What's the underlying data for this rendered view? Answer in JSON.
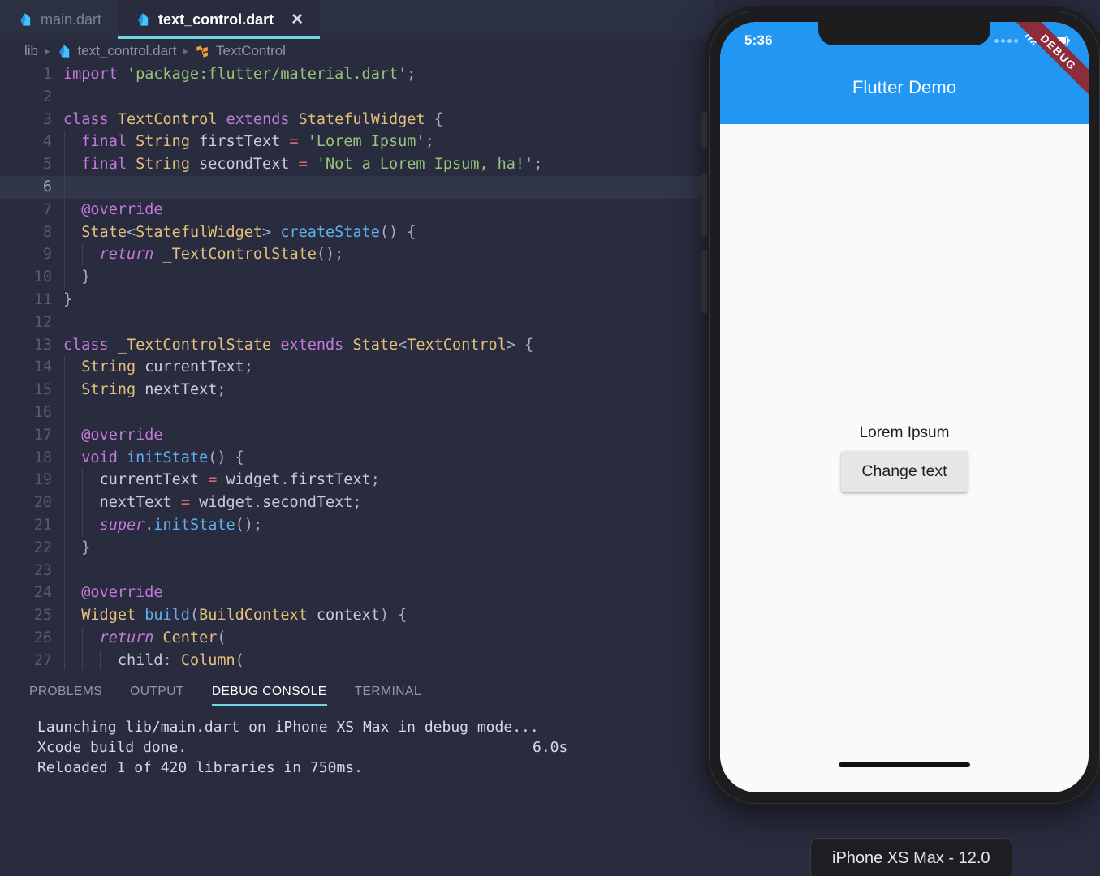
{
  "editor": {
    "tabs": [
      {
        "label": "main.dart",
        "icon": "dart-file-icon",
        "active": false,
        "closable": false
      },
      {
        "label": "text_control.dart",
        "icon": "dart-file-icon",
        "active": true,
        "closable": true,
        "close_glyph": "✕"
      }
    ],
    "breadcrumb": {
      "sep": "▸",
      "items": [
        {
          "label": "lib",
          "icon": null
        },
        {
          "label": "text_control.dart",
          "icon": "dart-file-icon"
        },
        {
          "label": "TextControl",
          "icon": "class-symbol-icon"
        }
      ]
    },
    "active_line": 6,
    "lines": [
      {
        "n": 1,
        "guides": 0,
        "text": "import 'package:flutter/material.dart';"
      },
      {
        "n": 2,
        "guides": 0,
        "text": ""
      },
      {
        "n": 3,
        "guides": 0,
        "text": "class TextControl extends StatefulWidget {"
      },
      {
        "n": 4,
        "guides": 1,
        "text": "  final String firstText = 'Lorem Ipsum';"
      },
      {
        "n": 5,
        "guides": 1,
        "text": "  final String secondText = 'Not a Lorem Ipsum, ha!';"
      },
      {
        "n": 6,
        "guides": 1,
        "text": ""
      },
      {
        "n": 7,
        "guides": 1,
        "text": "  @override"
      },
      {
        "n": 8,
        "guides": 1,
        "text": "  State<StatefulWidget> createState() {"
      },
      {
        "n": 9,
        "guides": 2,
        "text": "    return _TextControlState();"
      },
      {
        "n": 10,
        "guides": 1,
        "text": "  }"
      },
      {
        "n": 11,
        "guides": 0,
        "text": "}"
      },
      {
        "n": 12,
        "guides": 0,
        "text": ""
      },
      {
        "n": 13,
        "guides": 0,
        "text": "class _TextControlState extends State<TextControl> {"
      },
      {
        "n": 14,
        "guides": 1,
        "text": "  String currentText;"
      },
      {
        "n": 15,
        "guides": 1,
        "text": "  String nextText;"
      },
      {
        "n": 16,
        "guides": 1,
        "text": ""
      },
      {
        "n": 17,
        "guides": 1,
        "text": "  @override"
      },
      {
        "n": 18,
        "guides": 1,
        "text": "  void initState() {"
      },
      {
        "n": 19,
        "guides": 2,
        "text": "    currentText = widget.firstText;"
      },
      {
        "n": 20,
        "guides": 2,
        "text": "    nextText = widget.secondText;"
      },
      {
        "n": 21,
        "guides": 2,
        "text": "    super.initState();"
      },
      {
        "n": 22,
        "guides": 1,
        "text": "  }"
      },
      {
        "n": 23,
        "guides": 1,
        "text": ""
      },
      {
        "n": 24,
        "guides": 1,
        "text": "  @override"
      },
      {
        "n": 25,
        "guides": 1,
        "text": "  Widget build(BuildContext context) {"
      },
      {
        "n": 26,
        "guides": 2,
        "text": "    return Center("
      },
      {
        "n": 27,
        "guides": 3,
        "text": "      child: Column("
      }
    ]
  },
  "panel": {
    "tabs": [
      {
        "label": "PROBLEMS",
        "active": false
      },
      {
        "label": "OUTPUT",
        "active": false
      },
      {
        "label": "DEBUG CONSOLE",
        "active": true
      },
      {
        "label": "TERMINAL",
        "active": false
      }
    ],
    "console_lines": [
      {
        "text": "Launching lib/main.dart on iPhone XS Max in debug mode...",
        "duration": ""
      },
      {
        "text": "Xcode build done.",
        "duration": "6.0s"
      },
      {
        "text": "Reloaded 1 of 420 libraries in 750ms.",
        "duration": ""
      }
    ]
  },
  "simulator": {
    "status_bar": {
      "time": "5:36",
      "signal_icon": "signal-dots-icon",
      "wifi_icon": "wifi-icon",
      "battery_icon": "battery-icon"
    },
    "debug_banner": "DEBUG",
    "app_bar_title": "Flutter Demo",
    "body": {
      "display_text": "Lorem Ipsum",
      "button_label": "Change text"
    },
    "device_chip": "iPhone XS Max - 12.0"
  },
  "colors": {
    "editor_bg": "#282c3e",
    "tabbar_bg": "#2b3042",
    "accent_underline": "#6ed8e0",
    "app_bar_blue": "#2196f3",
    "debug_banner_red": "#8d2c3c",
    "active_line_bg": "#31364a",
    "line_number": "#555b72"
  }
}
